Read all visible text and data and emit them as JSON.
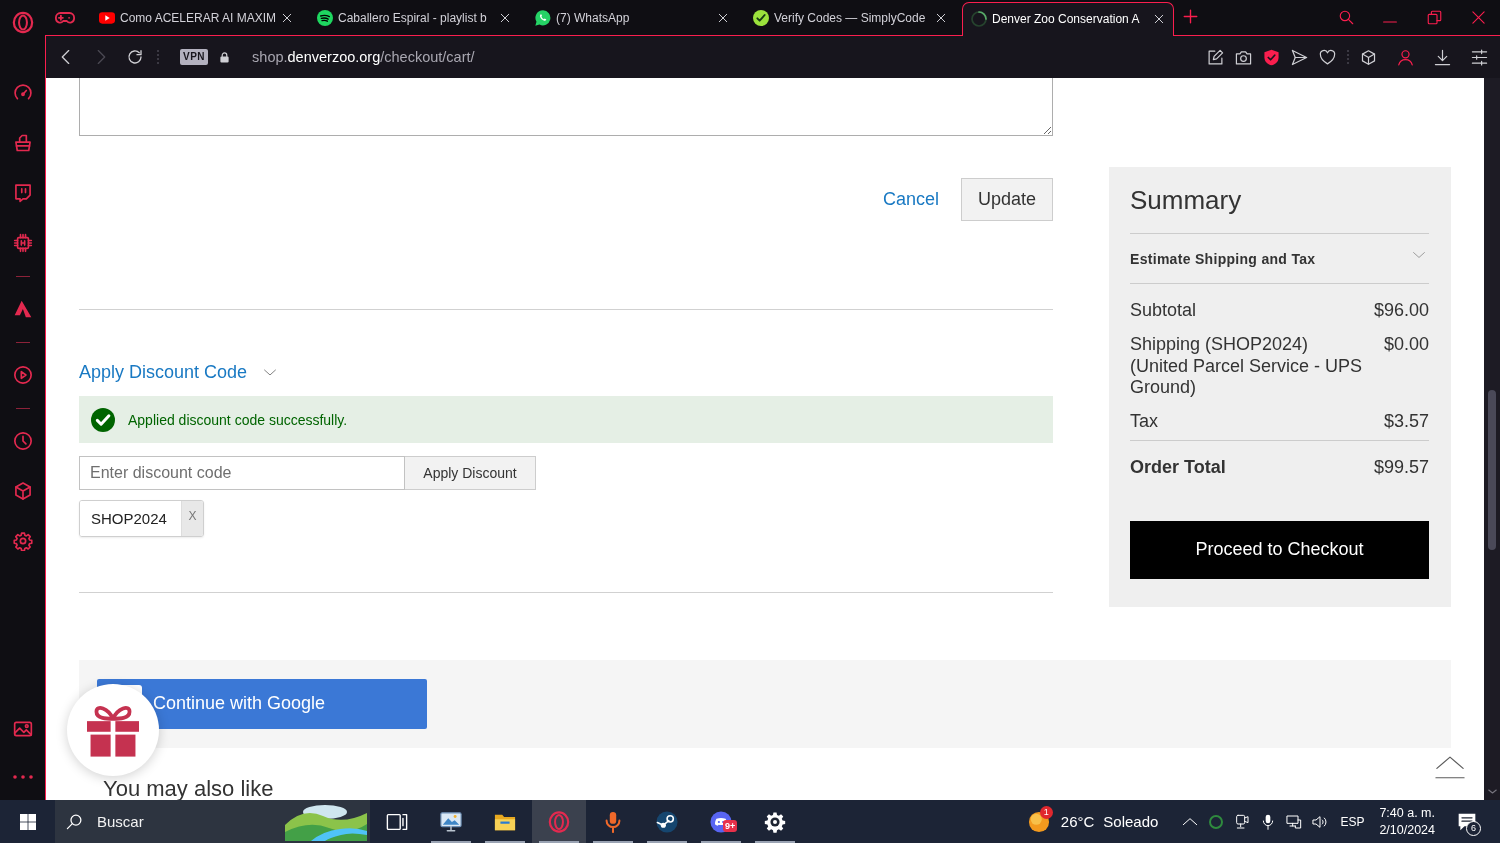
{
  "tab_bar": {
    "tabs": [
      {
        "kind": "youtube",
        "title": "Como ACELERAR AI MAXIM",
        "selected": false
      },
      {
        "kind": "spotify",
        "title": "Caballero Espiral - playlist b",
        "selected": false
      },
      {
        "kind": "whatsapp",
        "title": "(7) WhatsApp",
        "selected": false
      },
      {
        "kind": "simplycodes",
        "title": "Verify Codes — SimplyCode",
        "selected": false
      },
      {
        "kind": "loading",
        "title": "Denver Zoo Conservation A",
        "selected": true
      }
    ]
  },
  "toolbar": {
    "back": {
      "disabled": false
    },
    "forward": {
      "disabled": true
    },
    "vpn_badge": "VPN",
    "url": {
      "subdomain": "shop.",
      "domain": "denverzoo.org",
      "path": "/checkout/cart/"
    }
  },
  "cart": {
    "actions": {
      "cancel": "Cancel",
      "update": "Update"
    },
    "discount": {
      "toggle": "Apply Discount Code",
      "message": "Applied discount code successfully.",
      "code_field": {
        "placeholder": "Enter discount code"
      },
      "apply_button": "Apply Discount",
      "applied_codes": [
        {
          "code": "SHOP2024",
          "remove": "X"
        }
      ]
    },
    "social_login": {
      "google_button": "Continue with Google"
    },
    "related_heading": "You may also like"
  },
  "summary": {
    "title": "Summary",
    "estimate_toggle": "Estimate Shipping and Tax",
    "rows": [
      {
        "label": "Subtotal",
        "value": "$96.00"
      },
      {
        "label": "Shipping (SHOP2024)",
        "detail": "(United Parcel Service - UPS Ground)",
        "value": "$0.00"
      },
      {
        "label": "Tax",
        "value": "$3.57"
      }
    ],
    "total": {
      "label": "Order Total",
      "value": "$99.57"
    },
    "checkout_button": "Proceed to Checkout"
  },
  "taskbar": {
    "search": {
      "placeholder": "Buscar"
    },
    "apps": [
      {
        "kind": "task-view",
        "running": false,
        "active": false
      },
      {
        "kind": "picture-monitor",
        "running": true,
        "active": false
      },
      {
        "kind": "folder",
        "running": true,
        "active": false
      },
      {
        "kind": "ring-logo",
        "running": true,
        "active": true
      },
      {
        "kind": "microphone",
        "running": true,
        "active": false
      },
      {
        "kind": "disc-logo",
        "running": true,
        "active": false
      },
      {
        "kind": "controller-logo",
        "running": true,
        "active": false,
        "badge": "9+"
      },
      {
        "kind": "cog",
        "running": true,
        "active": false
      }
    ],
    "weather": {
      "temperature": "26°C",
      "condition": "Soleado",
      "badge": "1"
    },
    "language": "ESP",
    "clock": {
      "time": "7:40 a. m.",
      "date": "2/10/2024"
    },
    "notifications": {
      "badge": "6"
    }
  }
}
